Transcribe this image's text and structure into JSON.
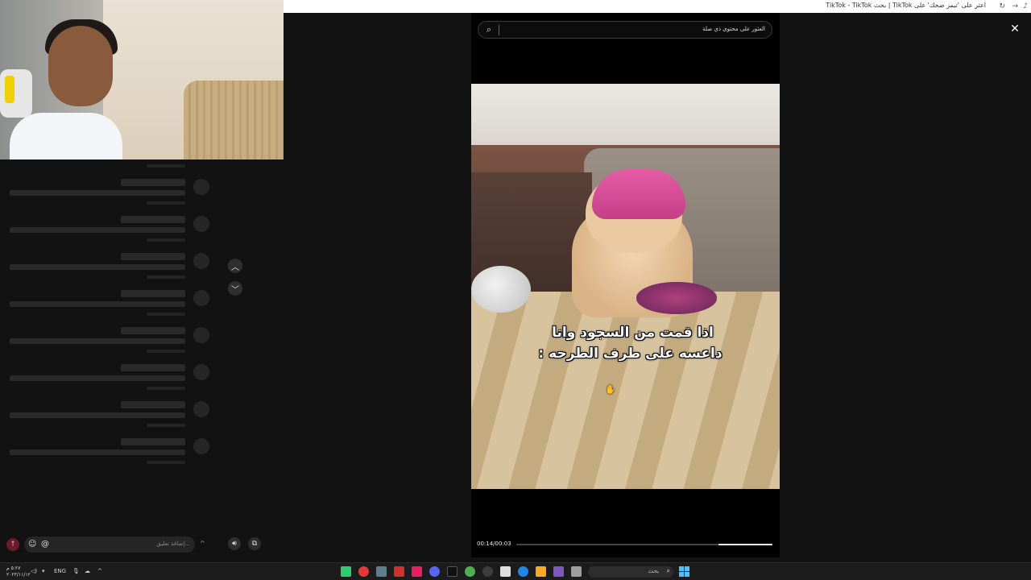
{
  "browser": {
    "tab_title": "TikTok - TikTok بحث | TikTok اعثر على 'تيمز ضحك' على"
  },
  "search": {
    "placeholder": "العثور على محتوى ذي صلة"
  },
  "video": {
    "caption_line1": "اذا قمت من السجود وانا",
    "caption_line2": "داعسه على طرف الطرحه :",
    "timecode": "00:14/00:03",
    "progress_fraction": 0.21
  },
  "comment_input": {
    "placeholder": "إضافة تعليق..."
  },
  "taskbar": {
    "search_placeholder": "بحث",
    "language": "ENG",
    "time": "٥:٢٧ م",
    "date": "٢٠٢٣/١١/١٢"
  },
  "colors": {
    "accent_progress": "#f0f0f0",
    "send_button": "#6b1a2a",
    "hat": "#e45ca6"
  }
}
